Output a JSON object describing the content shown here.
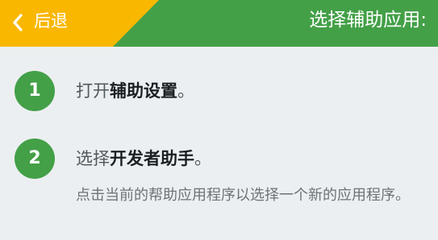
{
  "header": {
    "back_label": "后退",
    "title": "选择辅助应用:",
    "back_icon": "chevron-left-icon",
    "colors": {
      "back_area": "#f9b700",
      "bar": "#43a047"
    }
  },
  "steps": [
    {
      "number": "1",
      "prefix": "打开",
      "strong": "辅助设置",
      "suffix": "。"
    },
    {
      "number": "2",
      "prefix": "选择",
      "strong": "开发者助手",
      "suffix": "。",
      "description": "点击当前的帮助应用程序以选择一个新的应用程序。"
    }
  ]
}
